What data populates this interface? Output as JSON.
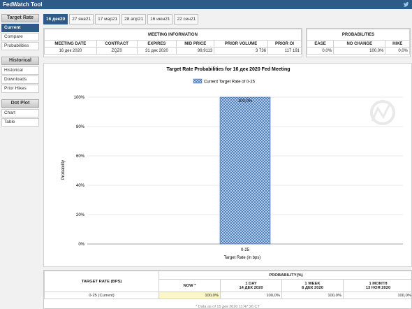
{
  "app": {
    "title": "FedWatch Tool"
  },
  "sidebar": {
    "sections": [
      {
        "heading": "Target Rate",
        "items": [
          "Current",
          "Compare",
          "Probabilities"
        ]
      },
      {
        "heading": "Historical",
        "items": [
          "Historical",
          "Downloads",
          "Prior Hikes"
        ]
      },
      {
        "heading": "Dot Plot",
        "items": [
          "Chart",
          "Table"
        ]
      }
    ],
    "active_item": "Current"
  },
  "tabs": [
    "16 дек20",
    "27 янв21",
    "17 мар21",
    "28 апр21",
    "16 июн21",
    "22 сен21"
  ],
  "meeting_info": {
    "caption": "MEETING INFORMATION",
    "headers": [
      "MEETING DATE",
      "CONTRACT",
      "EXPIRES",
      "MID PRICE",
      "PRIOR VOLUME",
      "PRIOR OI"
    ],
    "row": [
      "16 дек 2020",
      "ZQZ0",
      "31 дек 2020",
      "99,9113",
      "3 736",
      "117 191"
    ]
  },
  "probabilities": {
    "caption": "PROBABILITIES",
    "headers": [
      "EASE",
      "NO CHANGE",
      "HIKE"
    ],
    "row": [
      "0,0%",
      "100,0%",
      "0,0%"
    ]
  },
  "chart_data": {
    "type": "bar",
    "title": "Target Rate Probabilities for 16 дек 2020 Fed Meeting",
    "legend": "Current Target Rate of 0-25",
    "legend_position": "top-center",
    "categories": [
      "0-25"
    ],
    "values": [
      100.0
    ],
    "data_labels": [
      "100,0%"
    ],
    "xlabel": "Target Rate (in bps)",
    "ylabel": "Probability",
    "yticks": [
      "0%",
      "20%",
      "40%",
      "60%",
      "80%",
      "100%"
    ],
    "ylim": [
      0,
      100
    ],
    "grid": true,
    "bar_color": "#3a6fb0"
  },
  "bottom_table": {
    "left_header": "TARGET RATE (BPS)",
    "prob_header": "PROBABILITY(%)",
    "columns": [
      {
        "label": "NOW *",
        "sub": ""
      },
      {
        "label": "1 DAY",
        "sub": "14 ДЕК 2020"
      },
      {
        "label": "1 WEEK",
        "sub": "8 ДЕК 2020"
      },
      {
        "label": "1 MONTH",
        "sub": "13 НОЯ 2020"
      }
    ],
    "rows": [
      {
        "rate": "0-25 (Current)",
        "values": [
          "100,0%",
          "100,0%",
          "100,0%",
          "100,0%"
        ]
      }
    ],
    "footnote": "* Data as of 15 дек 2020 11:47:26 CT"
  },
  "colors": {
    "header_bg": "#2d5a86",
    "now_highlight": "#fbf7c6"
  }
}
